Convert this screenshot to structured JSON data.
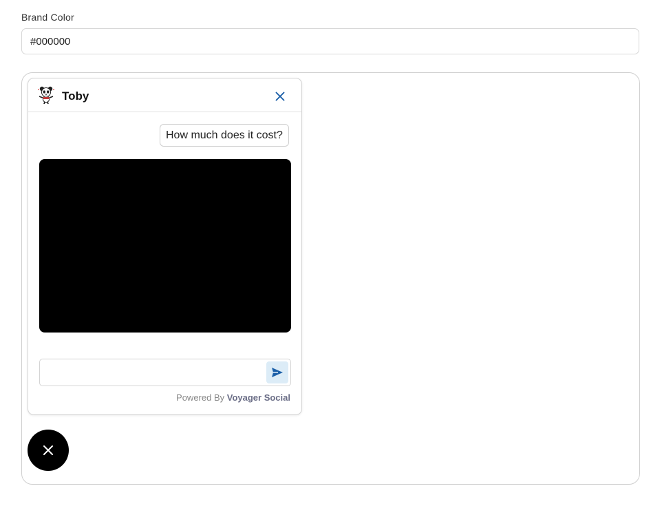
{
  "settings": {
    "brand_color_label": "Brand Color",
    "brand_color_value": "#000000"
  },
  "chat": {
    "bot_name": "Toby",
    "avatar_icon": "panda-mascot-icon",
    "close_icon": "close-icon",
    "messages": [
      {
        "role": "user",
        "text": "How much does it cost?"
      }
    ],
    "bot_response_color": "#000000",
    "input_value": "",
    "input_placeholder": "",
    "send_icon": "send-icon",
    "powered_by_prefix": "Powered By",
    "powered_by_brand": "Voyager Social"
  },
  "launcher": {
    "icon": "close-icon",
    "color": "#000000"
  },
  "colors": {
    "accent": "#1b5fa8",
    "send_bg": "#dcecf7",
    "brand": "#000000"
  }
}
